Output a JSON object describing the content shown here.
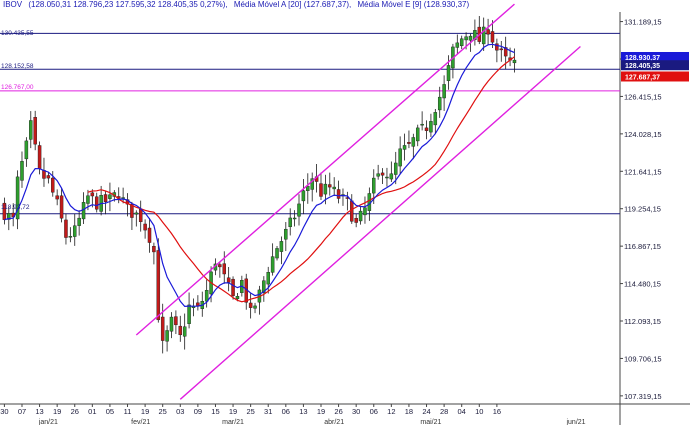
{
  "header": {
    "symbol": "IBOV",
    "ohlc": "(128.050,31  128.796,23  127.595,32  128.405,35  0,27%),",
    "ma_a_label": "Média Móvel A [20] (127.687,37),",
    "ma_e_label": "Média Móvel E [9] (128.930,37)"
  },
  "level_labels": {
    "upper": "130.435,55",
    "mid": "128.152,58",
    "pink": "126.767,00",
    "low": "118.93,72"
  },
  "colors": {
    "bull": "#2e9e2e",
    "bear": "#c21a1a",
    "ma_a": "#e01010",
    "ma_e": "#1a1ad8",
    "channel": "#e020e0",
    "hline": "#1a1a80",
    "price_tag": "#1a1a80",
    "ma_e_tag": "#1a1ad8",
    "ma_a_tag": "#e01010"
  },
  "chart_data": {
    "type": "candlestick",
    "ylim": [
      106800,
      131800
    ],
    "y_ticks": [
      "131.189,15",
      "128.802,15",
      "126.415,15",
      "124.028,15",
      "121.641,15",
      "119.254,15",
      "116.867,15",
      "114.480,15",
      "112.093,15",
      "109.706,15",
      "107.319,15"
    ],
    "y_tick_values": [
      131189.15,
      128802.15,
      126415.15,
      124028.15,
      121641.15,
      119254.15,
      116867.15,
      114480.15,
      112093.15,
      109706.15,
      107319.15
    ],
    "x_labels": [
      "30",
      "07",
      "13",
      "19",
      "26",
      "01",
      "05",
      "11",
      "19",
      "25",
      "03",
      "09",
      "15",
      "19",
      "25",
      "31",
      "06",
      "13",
      "19",
      "26",
      "30",
      "06",
      "12",
      "18",
      "24",
      "28",
      "04",
      "10",
      "16"
    ],
    "x_label_index": [
      0,
      4,
      8,
      12,
      16,
      20,
      24,
      28,
      32,
      36,
      40,
      44,
      48,
      52,
      56,
      60,
      64,
      68,
      72,
      76,
      80,
      84,
      88,
      92,
      96,
      100,
      104,
      108,
      112
    ],
    "extra_x_label": "jun/21",
    "extra_x_label_index": 130,
    "months": [
      {
        "label": "jan/21",
        "index": 10
      },
      {
        "label": "fev/21",
        "index": 31
      },
      {
        "label": "mar/21",
        "index": 52
      },
      {
        "label": "abr/21",
        "index": 75
      },
      {
        "label": "mai/21",
        "index": 97
      },
      {
        "label": "jun/21",
        "index": 130
      }
    ],
    "x_domain": [
      -1,
      140
    ],
    "candles": [],
    "h_lines": [
      {
        "name": "upper",
        "value": 130435.55
      },
      {
        "name": "mid",
        "value": 128152.58
      },
      {
        "name": "low",
        "value": 118930
      }
    ],
    "pink_line": 126767.0,
    "channel": [
      {
        "name": "upper",
        "from": [
          30,
          111200
        ],
        "to": [
          116,
          132300
        ]
      },
      {
        "name": "lower",
        "from": [
          40,
          107100
        ],
        "to": [
          131,
          129600
        ]
      }
    ],
    "price_tags": [
      {
        "label": "128.930,37",
        "value": 128930.37,
        "kind": "ma_e_tag"
      },
      {
        "label": "128.405,35",
        "value": 128405.35,
        "kind": "price_tag"
      },
      {
        "label": "127.687,37",
        "value": 127687.37,
        "kind": "ma_a_tag"
      }
    ]
  }
}
